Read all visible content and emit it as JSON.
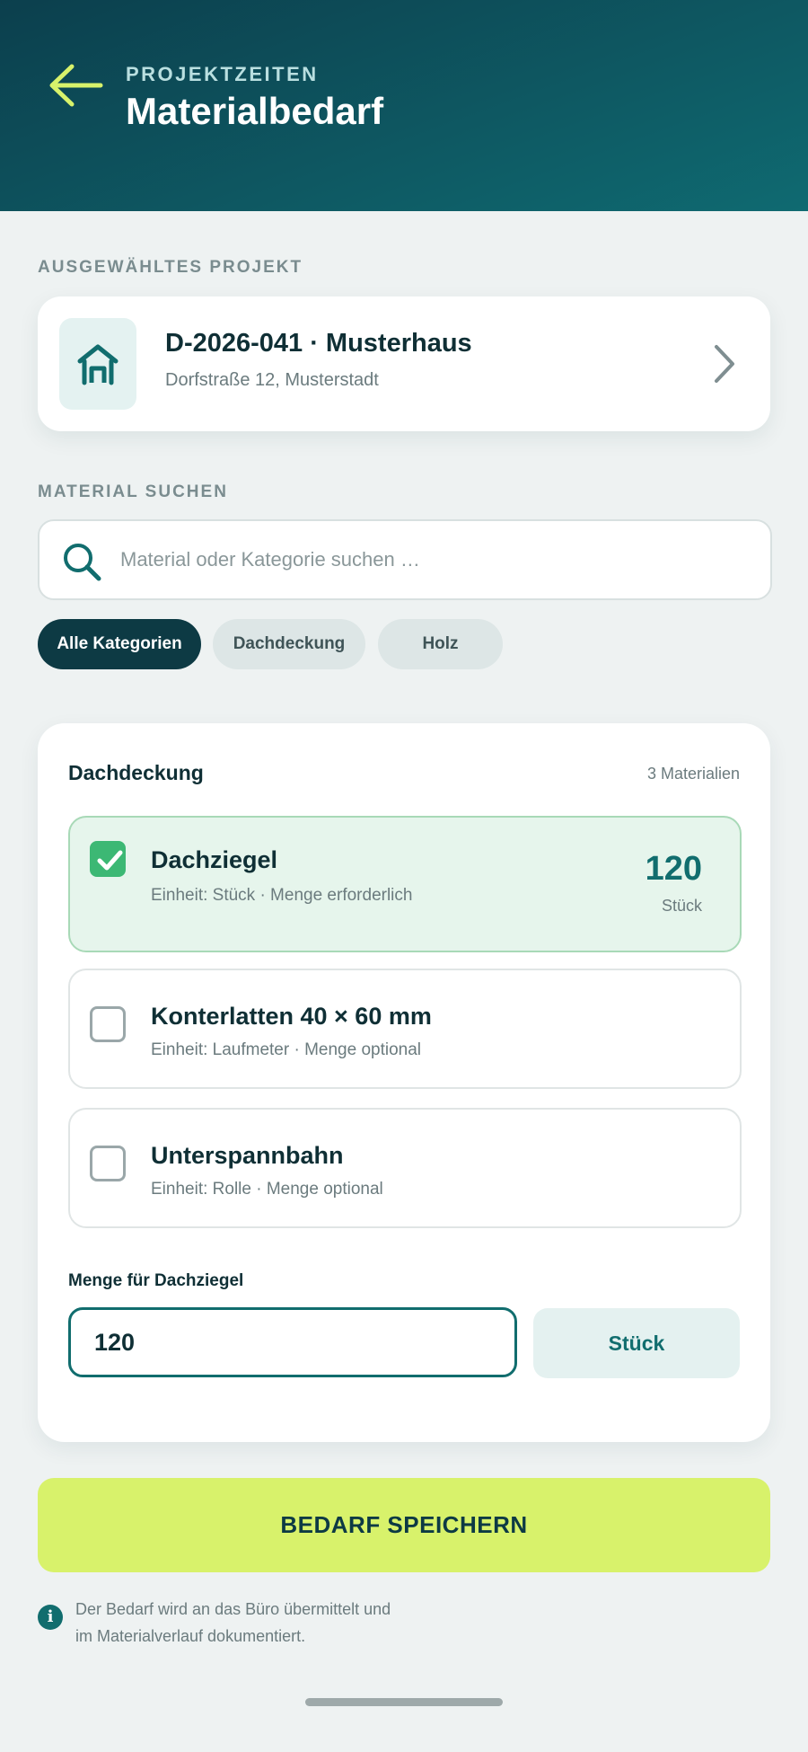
{
  "header": {
    "eyebrow": "PROJEKTZEITEN",
    "title": "Materialbedarf",
    "back_icon": "arrow-left-icon",
    "accent": "#d8f26b"
  },
  "project_section": {
    "label": "AUSGEWÄHLTES PROJEKT",
    "project": {
      "title": "D-2026-041 · Musterhaus",
      "address": "Dorfstraße 12, Musterstadt",
      "icon": "house-icon"
    }
  },
  "search_section": {
    "label": "MATERIAL SUCHEN",
    "placeholder": "Material oder Kategorie suchen …",
    "value": ""
  },
  "filters": [
    {
      "label": "Alle Kategorien",
      "active": true
    },
    {
      "label": "Dachdeckung",
      "active": false
    },
    {
      "label": "Holz",
      "active": false
    }
  ],
  "material_panel": {
    "category": "Dachdeckung",
    "count": "3 Materialien",
    "items": [
      {
        "name": "Dachziegel",
        "meta": "Einheit: Stück · Menge erforderlich",
        "checked": true,
        "qty": "120",
        "unit": "Stück"
      },
      {
        "name": "Konterlatten 40 × 60 mm",
        "meta": "Einheit: Laufmeter · Menge optional",
        "checked": false
      },
      {
        "name": "Unterspannbahn",
        "meta": "Einheit: Rolle · Menge optional",
        "checked": false
      }
    ],
    "quantity_label": "Menge für Dachziegel",
    "quantity_value": "120",
    "unit_label": "Stück"
  },
  "actions": {
    "save": "BEDARF SPEICHERN"
  },
  "info": {
    "line1": "Der Bedarf wird an das Büro übermittelt und",
    "line2": "im Materialverlauf dokumentiert."
  },
  "colors": {
    "header_dark": "#0c3f4d",
    "header_teal": "#0f6a71",
    "teal": "#116d6e",
    "success": "#3cb874",
    "cta": "#d8f26b"
  }
}
